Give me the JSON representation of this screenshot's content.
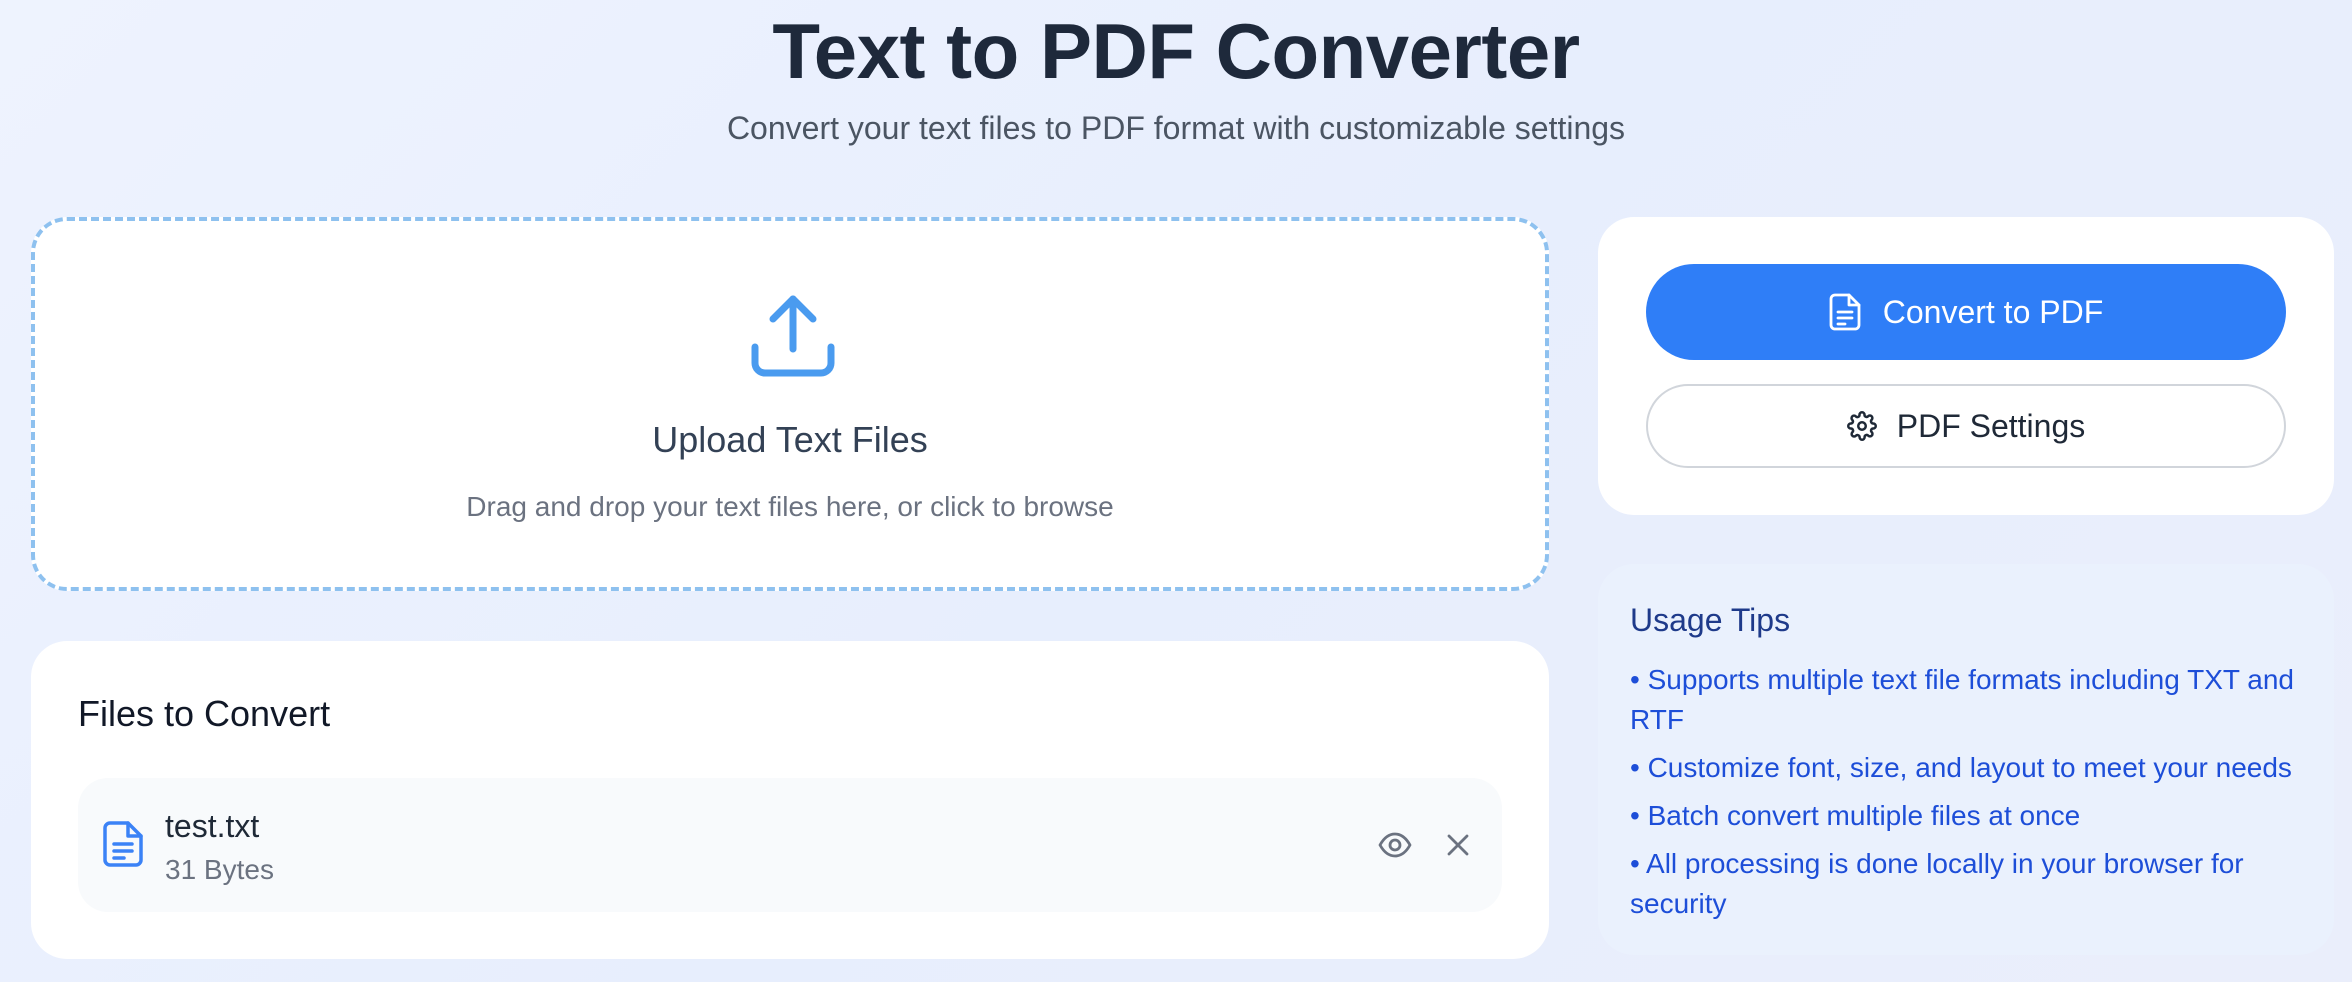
{
  "header": {
    "title": "Text to PDF Converter",
    "subtitle": "Convert your text files to PDF format with customizable settings"
  },
  "upload": {
    "icon": "upload-icon",
    "title": "Upload Text Files",
    "instruction": "Drag and drop your text files here, or click to browse"
  },
  "files": {
    "heading": "Files to Convert",
    "items": [
      {
        "name": "test.txt",
        "size": "31 Bytes",
        "icon": "file-text-icon"
      }
    ]
  },
  "actions": {
    "convert_label": "Convert to PDF",
    "settings_label": "PDF Settings"
  },
  "tips": {
    "heading": "Usage Tips",
    "items": [
      "• Supports multiple text file formats including TXT and RTF",
      "• Customize font, size, and layout to meet your needs",
      "• Batch convert multiple files at once",
      "• All processing is done locally in your browser for security"
    ]
  },
  "colors": {
    "primary": "#2f7ef7",
    "upload_border": "#8ec1ef",
    "tips_text": "#1d4ed8",
    "tips_bg": "#eaf1fd"
  }
}
